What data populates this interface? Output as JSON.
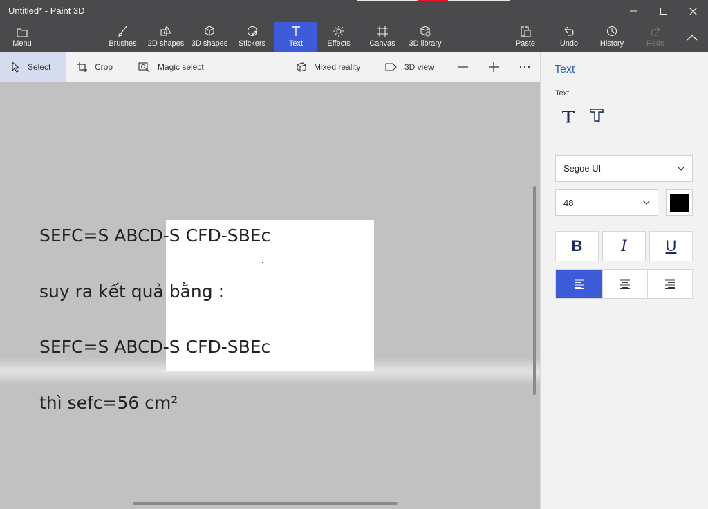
{
  "window": {
    "title": "Untitled* - Paint 3D",
    "controls": {
      "minimize": "minimize-icon",
      "maximize": "maximize-icon",
      "close": "close-icon"
    }
  },
  "ribbon": {
    "menu": "Menu",
    "tools": [
      {
        "label": "Brushes",
        "icon": "brush-icon"
      },
      {
        "label": "2D shapes",
        "icon": "2d-shapes-icon"
      },
      {
        "label": "3D shapes",
        "icon": "3d-shapes-icon"
      },
      {
        "label": "Stickers",
        "icon": "stickers-icon"
      },
      {
        "label": "Text",
        "icon": "text-icon",
        "active": true
      },
      {
        "label": "Effects",
        "icon": "effects-icon"
      },
      {
        "label": "Canvas",
        "icon": "canvas-icon"
      },
      {
        "label": "3D library",
        "icon": "3d-library-icon"
      }
    ],
    "actions": [
      {
        "label": "Paste",
        "icon": "paste-icon"
      },
      {
        "label": "Undo",
        "icon": "undo-icon"
      },
      {
        "label": "History",
        "icon": "history-icon"
      },
      {
        "label": "Redo",
        "icon": "redo-icon",
        "disabled": true
      }
    ],
    "collapse_icon": "chevron-up-icon"
  },
  "toolbar": {
    "select": "Select",
    "crop": "Crop",
    "magic_select": "Magic select",
    "mixed_reality": "Mixed reality",
    "view_3d": "3D view",
    "zoom_out_icon": "minus-icon",
    "zoom_in_icon": "plus-icon",
    "more_icon": "ellipsis-icon"
  },
  "canvas": {
    "lines": [
      "SEFC=S ABCD-S CFD-SBEc",
      "suy ra kết quả bằng :",
      "SEFC=S ABCD-S CFD-SBEc",
      "thì sefc=56 cm²"
    ]
  },
  "panel": {
    "title": "Text",
    "section": "Text",
    "font": "Segoe UI",
    "size": "48",
    "color": "#000000",
    "bold": "B",
    "italic": "I",
    "underline": "U",
    "align": "left"
  },
  "colors": {
    "accent": "#3d5bd9",
    "chrome": "#4a4a4c",
    "panel_title": "#2b62b8"
  }
}
